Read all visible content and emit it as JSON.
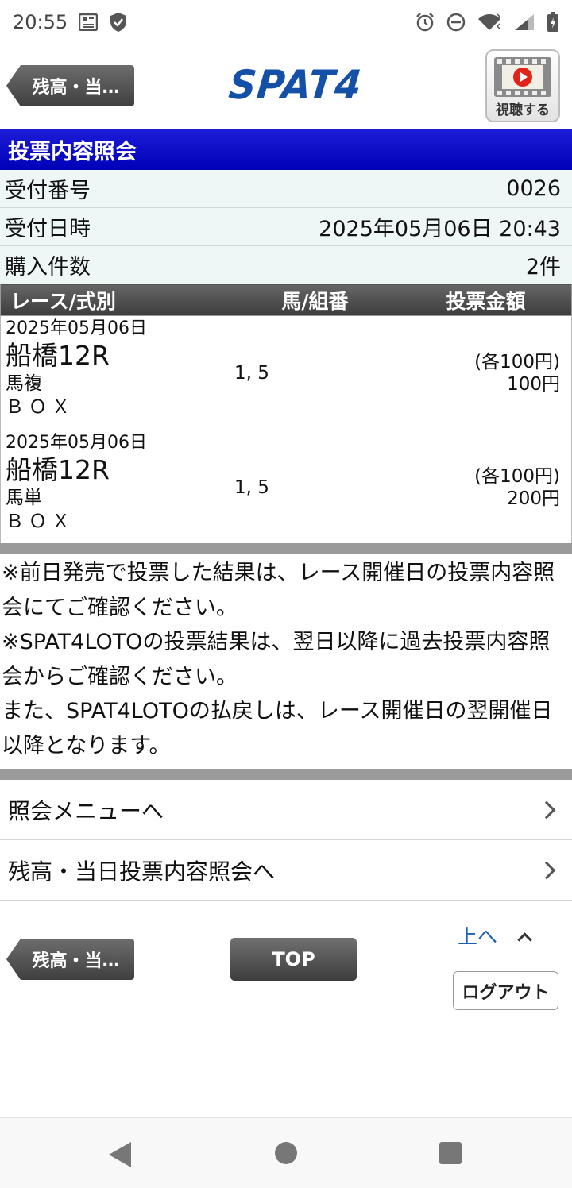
{
  "status_bar": {
    "time": "20:55",
    "left_icons": [
      "news-icon",
      "shield-icon"
    ],
    "right_icons": [
      "alarm-icon",
      "do-not-disturb-icon",
      "wifi-icon",
      "signal-icon",
      "battery-icon"
    ]
  },
  "header": {
    "back_label": "残高・当…",
    "logo": "SPAT4",
    "watch_label": "視聴する"
  },
  "page_title": "投票内容照会",
  "info": {
    "receipt_no": {
      "label": "受付番号",
      "value": "0026"
    },
    "received_at": {
      "label": "受付日時",
      "value": "2025年05月06日 20:43"
    },
    "count": {
      "label": "購入件数",
      "value": "2件"
    }
  },
  "table": {
    "headers": [
      "レース/式別",
      "馬/組番",
      "投票金額"
    ],
    "rows": [
      {
        "date": "2025年05月06日",
        "race": "船橋12R",
        "type": "馬複",
        "kind": "ＢＯＸ",
        "numbers": "1, 5",
        "unit": "(各100円)",
        "total": "100円"
      },
      {
        "date": "2025年05月06日",
        "race": "船橋12R",
        "type": "馬単",
        "kind": "ＢＯＸ",
        "numbers": "1, 5",
        "unit": "(各100円)",
        "total": "200円"
      }
    ]
  },
  "notes": [
    "※前日発売で投票した結果は、レース開催日の投票内容照会にてご確認ください。",
    "※SPAT4LOTOの投票結果は、翌日以降に過去投票内容照会からご確認ください。",
    "また、SPAT4LOTOの払戻しは、レース開催日の翌開催日以降となります。"
  ],
  "nav": [
    {
      "label": "照会メニューへ"
    },
    {
      "label": "残高・当日投票内容照会へ"
    }
  ],
  "footer": {
    "back_label": "残高・当…",
    "top_label": "TOP",
    "up_label": "上へ",
    "logout_label": "ログアウト"
  }
}
